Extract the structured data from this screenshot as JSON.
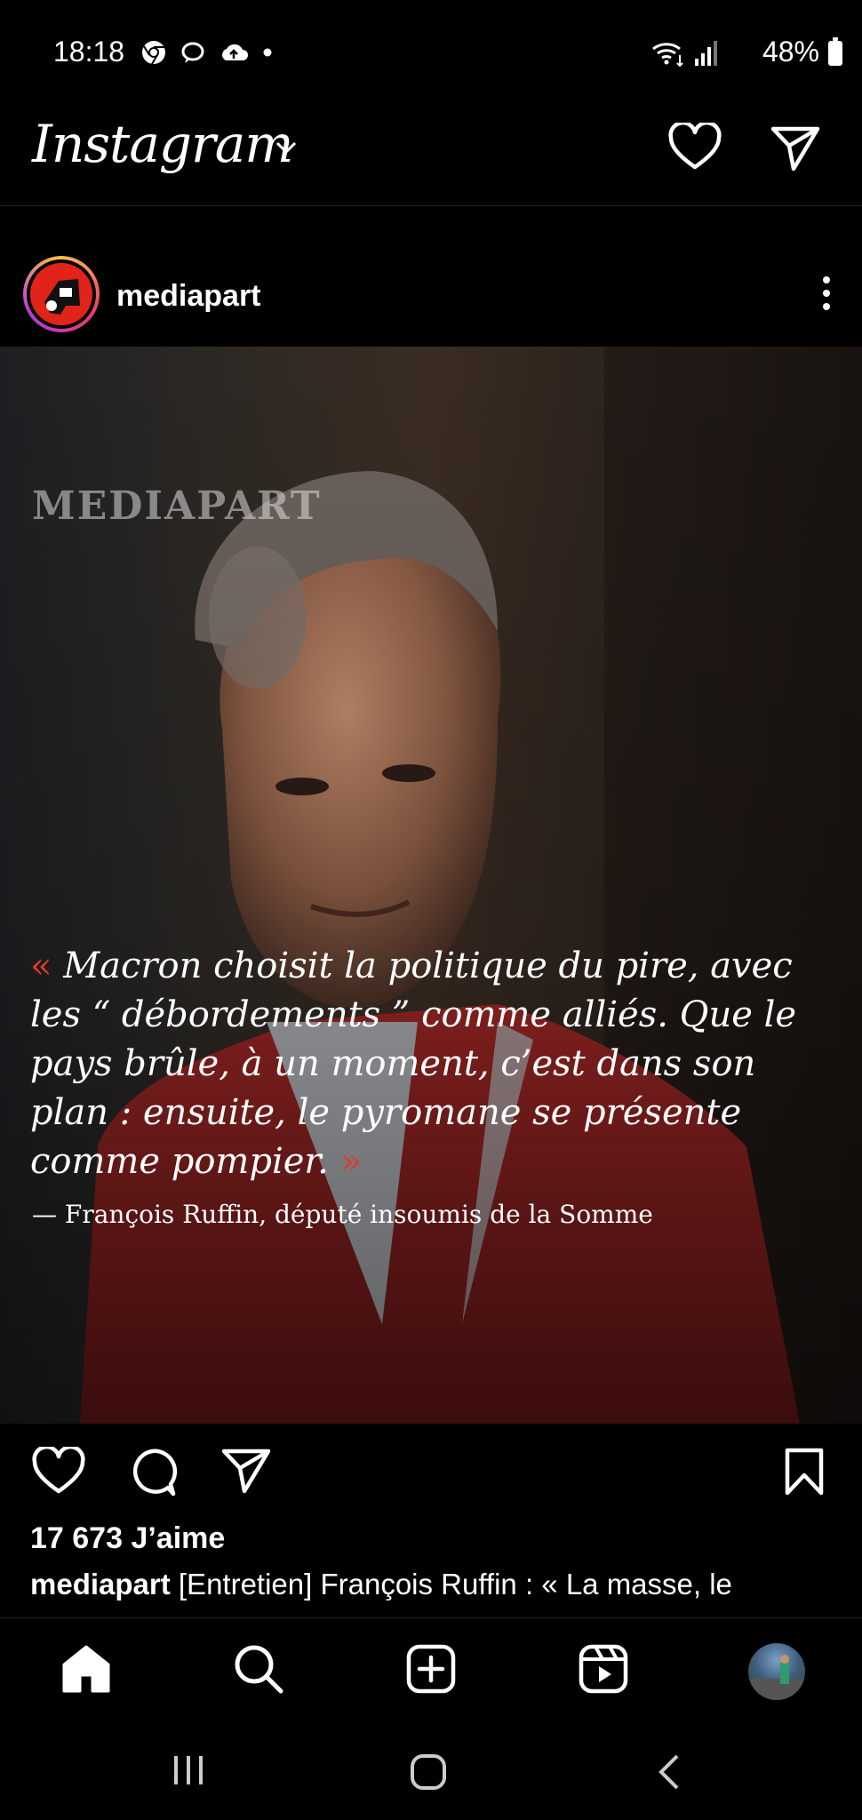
{
  "status_bar": {
    "time": "18:18",
    "battery_percent": "48%",
    "left_icons": [
      "chrome-icon",
      "chat-bubble-icon",
      "cloud-upload-icon",
      "dot-icon"
    ],
    "right_icons": [
      "wifi-icon",
      "signal-icon"
    ]
  },
  "header": {
    "logo_text": "Instagram",
    "actions": [
      "heart-icon",
      "send-icon"
    ]
  },
  "post": {
    "username": "mediapart",
    "image": {
      "watermark": "MEDIAPART",
      "quote_open": "«",
      "quote_text": " Macron choisit la politique du pire, avec les “ débordements ” comme alliés. Que le pays brûle, à un moment, c’est dans son plan : ensuite, le pyromane se présente comme pompier. ",
      "quote_close": "»",
      "quote_author": "— François Ruffin, député insoumis de la Somme"
    },
    "likes": "17 673 J’aime",
    "caption_user": "mediapart",
    "caption_text": " [Entretien] François Ruffin : « La masse, le"
  },
  "bottom_nav": {
    "items": [
      "home-icon",
      "search-icon",
      "create-icon",
      "reels-icon",
      "profile-avatar"
    ]
  },
  "colors": {
    "background": "#000000",
    "accent_red": "#e23a2a",
    "text": "#ffffff"
  }
}
